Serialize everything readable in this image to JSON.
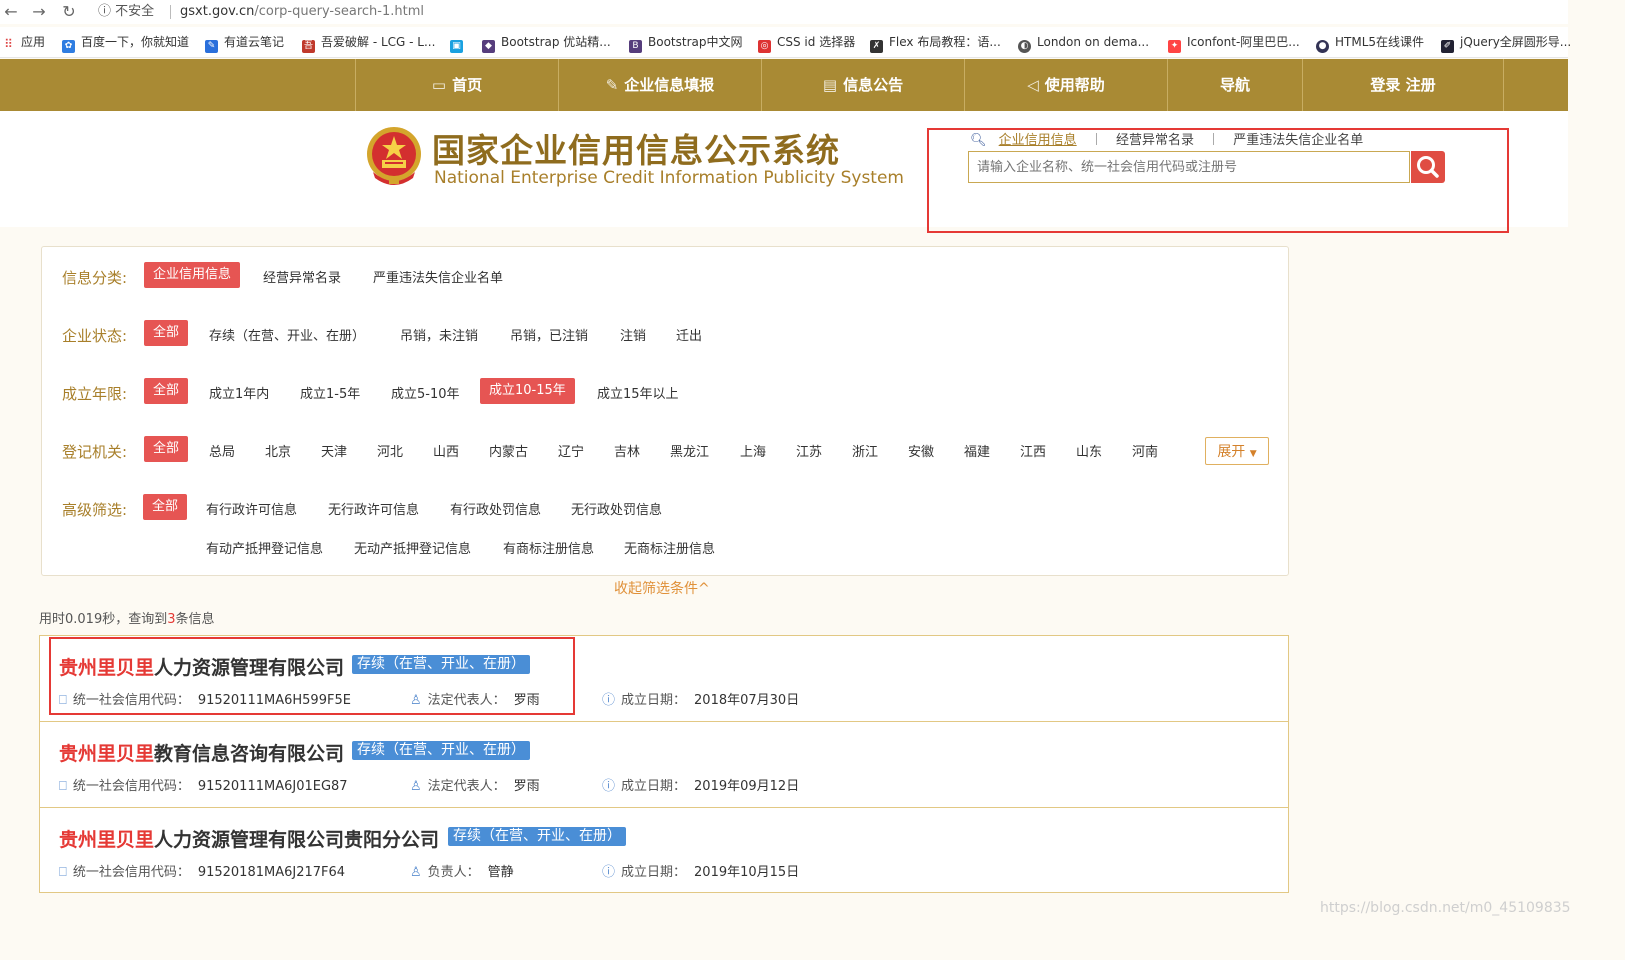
{
  "browser": {
    "security_label": "不安全",
    "url_host": "gsxt.gov.cn",
    "url_path": "/corp-query-search-1.html",
    "bookmarks": [
      {
        "label": "应用",
        "icon": "apps-grid-icon",
        "color": "#d44"
      },
      {
        "label": "百度一下，你就知道",
        "icon": "baidu-paw-icon",
        "color": "#2f7de1"
      },
      {
        "label": "有道云笔记",
        "icon": "youdao-note-icon",
        "color": "#2a6fdb"
      },
      {
        "label": "吾爱破解 - LCG - L...",
        "icon": "52pojie-icon",
        "color": "#c0392b"
      },
      {
        "label": "",
        "icon": "bilibili-tv-icon",
        "color": "#1aa1e0"
      },
      {
        "label": "Bootstrap 优站精...",
        "icon": "bootstrap-purple-icon",
        "color": "#563d7c"
      },
      {
        "label": "Bootstrap中文网",
        "icon": "bootstrap-b-icon",
        "color": "#563d7c"
      },
      {
        "label": "CSS id 选择器",
        "icon": "runoob-icon",
        "color": "#d33"
      },
      {
        "label": "Flex 布局教程：语...",
        "icon": "ruanyf-icon",
        "color": "#333"
      },
      {
        "label": "London on dema...",
        "icon": "globe-icon",
        "color": "#555"
      },
      {
        "label": "Iconfont-阿里巴巴...",
        "icon": "iconfont-icon",
        "color": "#f44"
      },
      {
        "label": "HTML5在线课件",
        "icon": "html5-course-icon",
        "color": "#335"
      },
      {
        "label": "jQuery全屏圆形导...",
        "icon": "jquery-icon",
        "color": "#223"
      }
    ]
  },
  "nav": {
    "items": [
      {
        "label": "首页",
        "icon": "monitor-icon",
        "glyph": "▭"
      },
      {
        "label": "企业信息填报",
        "icon": "edit-icon",
        "glyph": "✎"
      },
      {
        "label": "信息公告",
        "icon": "document-icon",
        "glyph": "▤"
      },
      {
        "label": "使用帮助",
        "icon": "speaker-icon",
        "glyph": "◁"
      },
      {
        "label": "导航",
        "icon": "",
        "glyph": ""
      },
      {
        "label": "登录  注册",
        "icon": "",
        "glyph": ""
      }
    ]
  },
  "header": {
    "title": "国家企业信用信息公示系统",
    "subtitle": "National Enterprise Credit Information Publicity System",
    "search_tabs": [
      "企业信用信息",
      "经营异常名录",
      "严重违法失信企业名单"
    ],
    "search_placeholder": "请输入企业名称、统一社会信用代码或注册号"
  },
  "filters": {
    "category": {
      "label": "信息分类:",
      "options": [
        "企业信用信息",
        "经营异常名录",
        "严重违法失信企业名单"
      ],
      "selected": 0
    },
    "status": {
      "label": "企业状态:",
      "options": [
        "全部",
        "存续（在营、开业、在册）",
        "吊销，未注销",
        "吊销，已注销",
        "注销",
        "迁出"
      ],
      "selected": 0
    },
    "age": {
      "label": "成立年限:",
      "options": [
        "全部",
        "成立1年内",
        "成立1-5年",
        "成立5-10年",
        "成立10-15年",
        "成立15年以上"
      ],
      "selected": [
        0,
        4
      ]
    },
    "authority": {
      "label": "登记机关:",
      "options": [
        "全部",
        "总局",
        "北京",
        "天津",
        "河北",
        "山西",
        "内蒙古",
        "辽宁",
        "吉林",
        "黑龙江",
        "上海",
        "江苏",
        "浙江",
        "安徽",
        "福建",
        "江西",
        "山东",
        "河南"
      ],
      "selected": 0,
      "expand_label": "展开"
    },
    "advanced": {
      "label": "高级筛选:",
      "row1": [
        "全部",
        "有行政许可信息",
        "无行政许可信息",
        "有行政处罚信息",
        "无行政处罚信息"
      ],
      "row2": [
        "有动产抵押登记信息",
        "无动产抵押登记信息",
        "有商标注册信息",
        "无商标注册信息"
      ],
      "selected": 0
    },
    "collapse_label": "收起筛选条件^"
  },
  "results": {
    "stats_prefix": "用时0.019秒，查询到",
    "count": "3",
    "stats_suffix": "条信息",
    "items": [
      {
        "name_hl": "贵州里贝里",
        "name_rest": "人力资源管理有限公司",
        "status": "存续（在营、开业、在册）",
        "code_label": "统一社会信用代码：",
        "code": "91520111MA6H599F5E",
        "rep_label": "法定代表人：",
        "rep": "罗雨",
        "date_label": "成立日期：",
        "date": "2018年07月30日"
      },
      {
        "name_hl": "贵州里贝里",
        "name_rest": "教育信息咨询有限公司",
        "status": "存续（在营、开业、在册）",
        "code_label": "统一社会信用代码：",
        "code": "91520111MA6J01EG87",
        "rep_label": "法定代表人：",
        "rep": "罗雨",
        "date_label": "成立日期：",
        "date": "2019年09月12日"
      },
      {
        "name_hl": "贵州里贝里",
        "name_rest": "人力资源管理有限公司贵阳分公司",
        "status": "存续（在营、开业、在册）",
        "code_label": "统一社会信用代码：",
        "code": "91520181MA6J217F64",
        "rep_label": "负责人：",
        "rep": "管静",
        "date_label": "成立日期：",
        "date": "2019年10月15日"
      }
    ]
  },
  "watermark": "https://blog.csdn.net/m0_45109835"
}
